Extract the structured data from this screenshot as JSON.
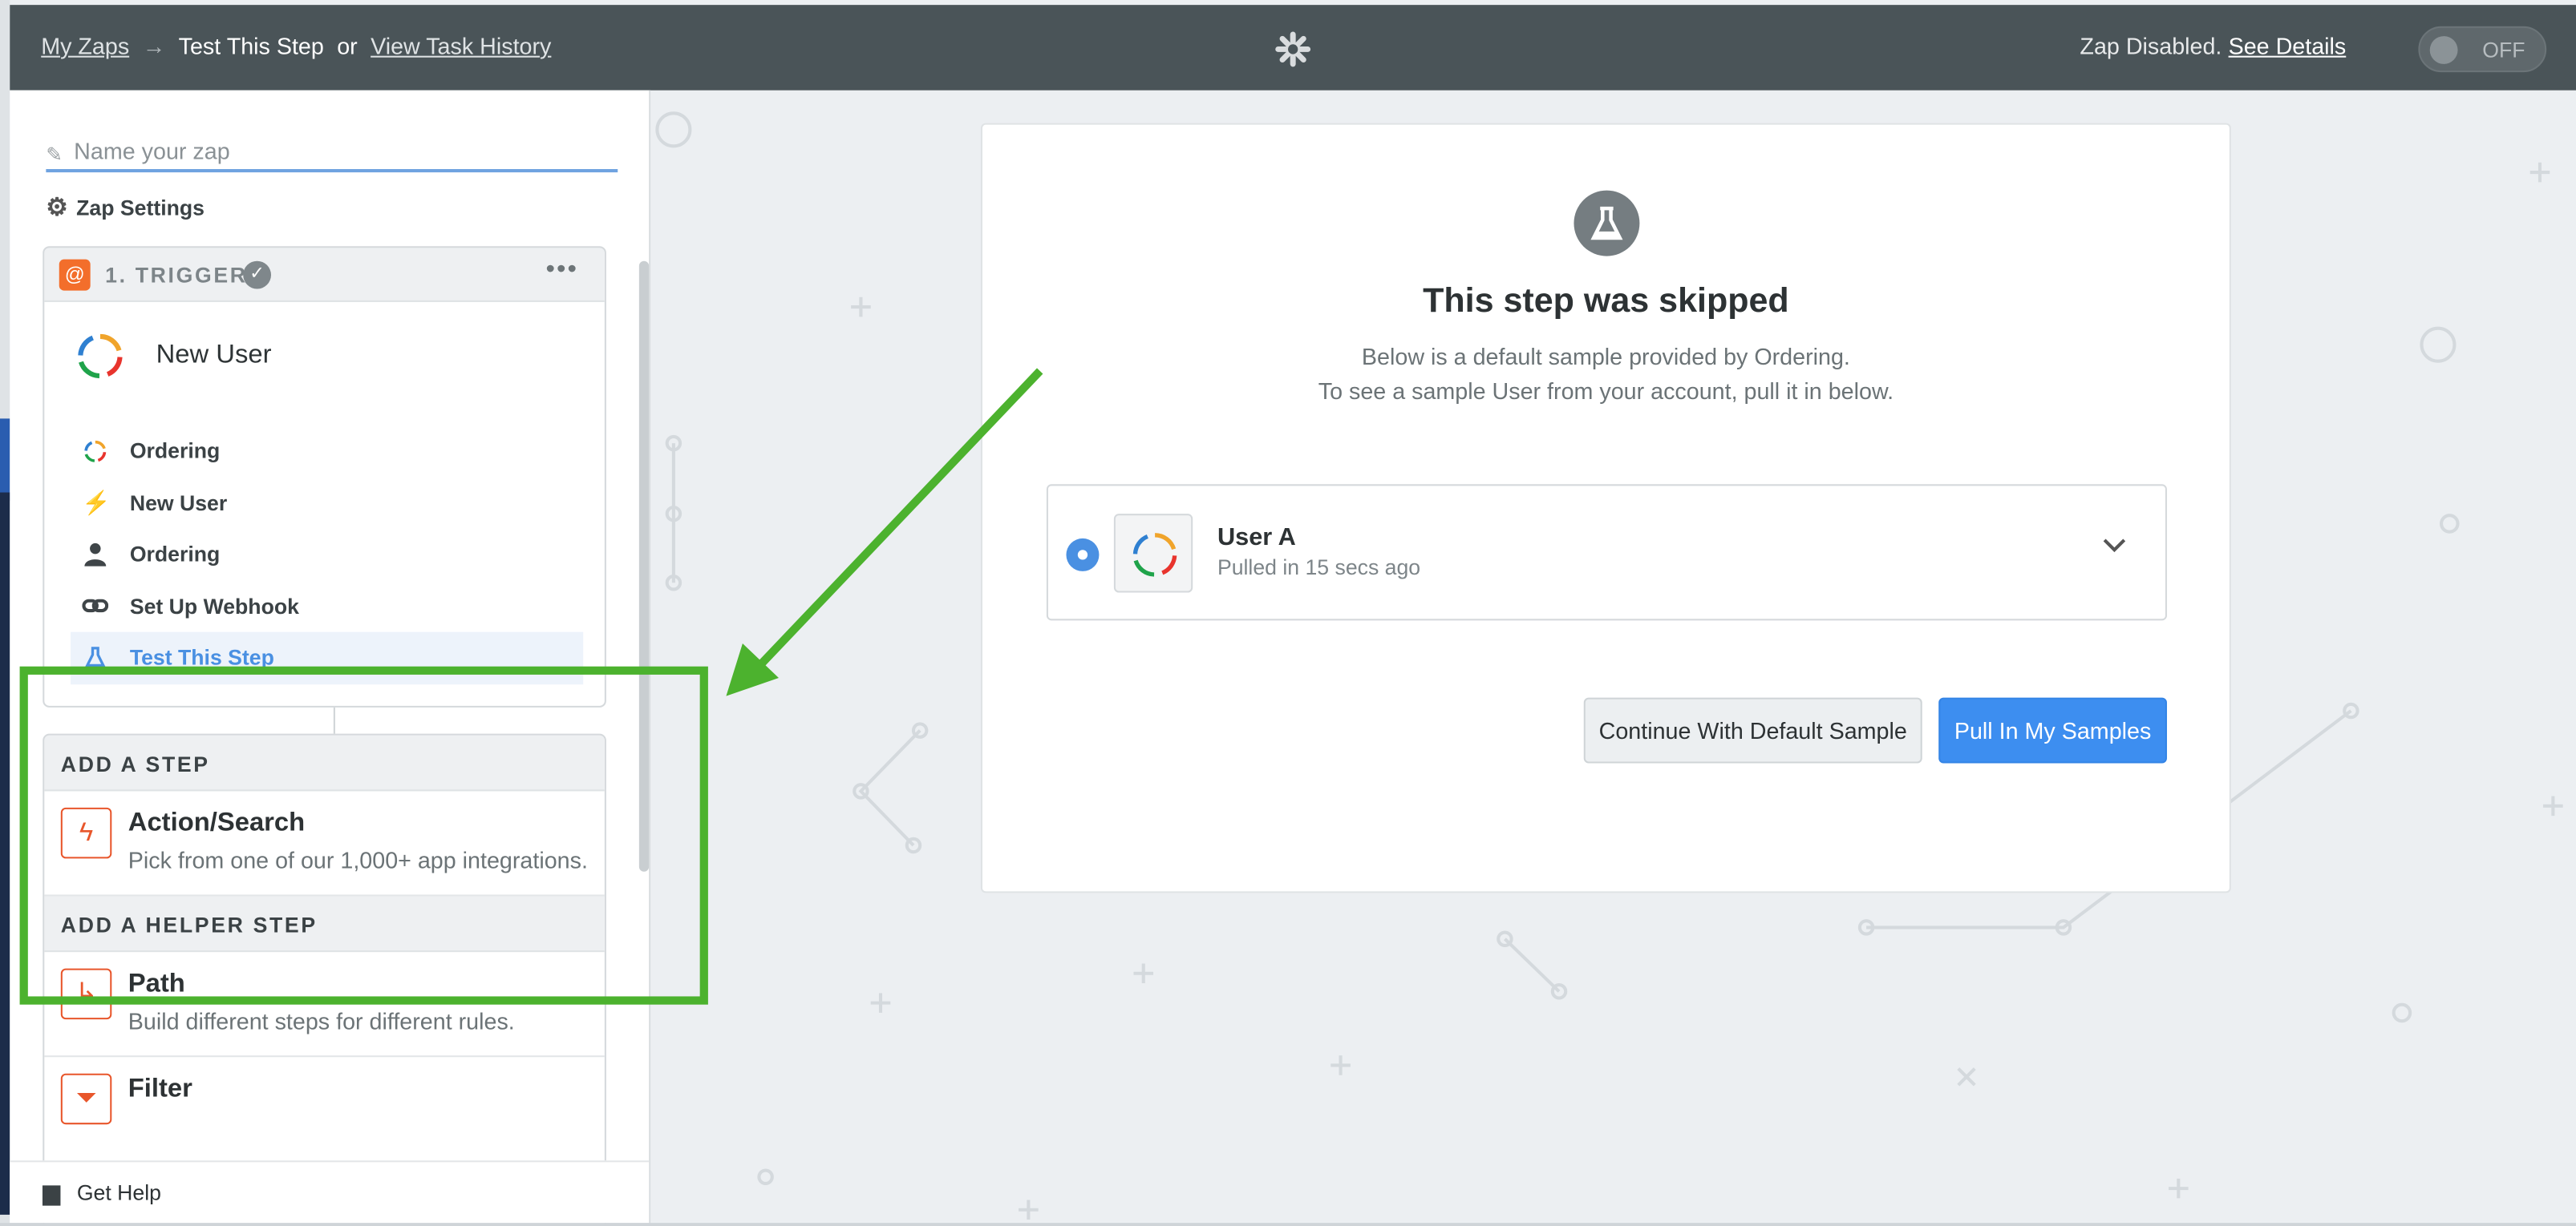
{
  "topbar": {
    "my_zaps": "My Zaps",
    "arrow": "→",
    "current": "Test This Step",
    "or": "or",
    "view_history": "View Task History",
    "status_text": "Zap Disabled.",
    "see_details": "See Details",
    "toggle_label": "OFF",
    "logo_icon": "zapier-asterisk-icon"
  },
  "sidebar": {
    "name_placeholder": "Name your zap",
    "zap_settings": "Zap Settings",
    "trigger": {
      "label": "1. TRIGGER",
      "title": "New User",
      "steps": [
        {
          "label": "Ordering",
          "icon": "ordering-ring-icon"
        },
        {
          "label": "New User",
          "icon": "bolt-icon"
        },
        {
          "label": "Ordering",
          "icon": "person-icon"
        },
        {
          "label": "Set Up Webhook",
          "icon": "link-icon"
        },
        {
          "label": "Test This Step",
          "icon": "flask-icon",
          "active": true
        }
      ]
    },
    "add_step": {
      "heading": "ADD A STEP",
      "action_title": "Action/Search",
      "action_desc": "Pick from one of our 1,000+ app integrations."
    },
    "helper": {
      "heading": "ADD A HELPER STEP",
      "path_title": "Path",
      "path_desc": "Build different steps for different rules.",
      "filter_title": "Filter"
    },
    "get_help": "Get Help"
  },
  "main": {
    "title": "This step was skipped",
    "sub_line1": "Below is a default sample provided by Ordering.",
    "sub_line2": "To see a sample User from your account, pull it in below.",
    "sample": {
      "name": "User A",
      "meta": "Pulled in 15 secs ago"
    },
    "btn_default": "Continue With Default Sample",
    "btn_primary": "Pull In My Samples"
  },
  "colors": {
    "accent_blue": "#3d8ef0",
    "topbar": "#4a5458",
    "annotation_green": "#4cb22e",
    "zapier_orange": "#f36e2b"
  }
}
